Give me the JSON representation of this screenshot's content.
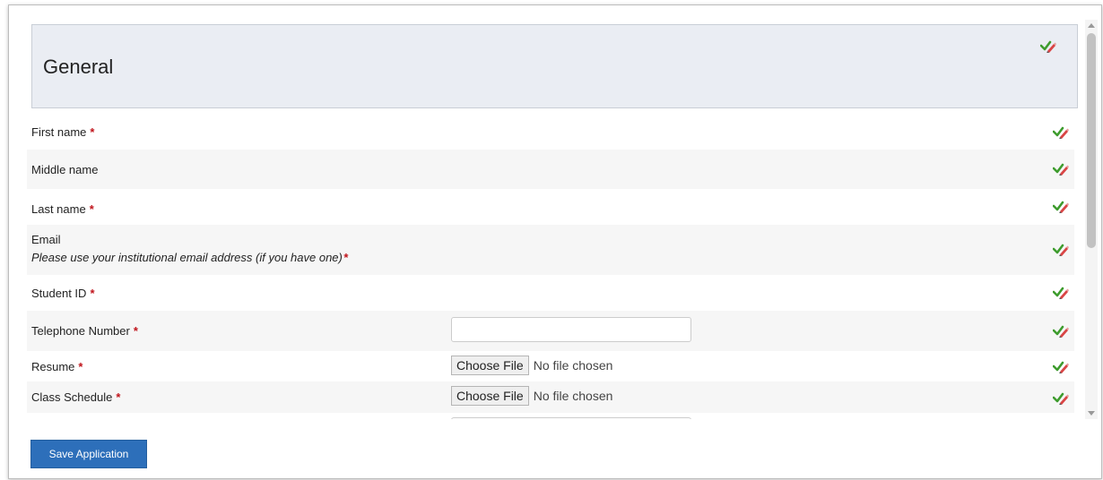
{
  "section": {
    "title": "General"
  },
  "fields": {
    "first_name": {
      "label": "First name",
      "required": "*"
    },
    "middle_name": {
      "label": "Middle name"
    },
    "last_name": {
      "label": "Last name",
      "required": "*"
    },
    "email": {
      "label": "Email",
      "help": "Please use your institutional email address (if you have one)",
      "required": "*"
    },
    "student_id": {
      "label": "Student ID",
      "required": "*"
    },
    "telephone": {
      "label": "Telephone Number",
      "required": "*",
      "value": ""
    },
    "resume": {
      "label": "Resume",
      "required": "*",
      "button": "Choose File",
      "status": "No file chosen"
    },
    "class_schedule": {
      "label": "Class Schedule",
      "required": "*",
      "button": "Choose File",
      "status": "No file chosen"
    }
  },
  "actions": {
    "save_label": "Save Application"
  },
  "icons": {
    "edit": "edit-pencil-icon",
    "accent": "#2d6fba",
    "required_color": "#c0141b"
  }
}
